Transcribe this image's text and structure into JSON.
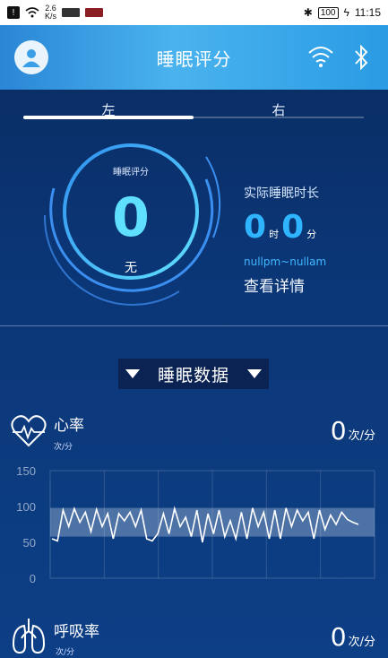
{
  "status_bar": {
    "speed_top": "2.6",
    "speed_bottom": "K/s",
    "battery": "100",
    "time": "11:15"
  },
  "header": {
    "title": "睡眠评分",
    "icons": [
      "avatar-icon",
      "wifi-icon",
      "bluetooth-icon"
    ]
  },
  "tabs": [
    {
      "label": "左",
      "active": true
    },
    {
      "label": "右",
      "active": false
    }
  ],
  "score": {
    "label": "睡眠评分",
    "value": "0",
    "grade": "无"
  },
  "actual_sleep": {
    "title": "实际睡眠时长",
    "hours": "0",
    "hours_unit": "时",
    "minutes": "0",
    "minutes_unit": "分",
    "time_range": "nullpm~nullam",
    "detail_label": "查看详情"
  },
  "section": {
    "title": "睡眠数据"
  },
  "heart_rate": {
    "name": "心率",
    "unit_small": "次/分",
    "value": "0",
    "unit": "次/分"
  },
  "respiration": {
    "name": "呼吸率",
    "unit_small": "次/分",
    "value": "0",
    "unit": "次/分"
  },
  "colors": {
    "accent": "#2fb4ff",
    "score": "#5fe0ff",
    "header": "#3ea6e8"
  },
  "chart_data": {
    "type": "line",
    "ylim": [
      0,
      150
    ],
    "yticks": [
      "150",
      "100",
      "50",
      "0"
    ],
    "band": [
      58,
      98
    ],
    "series": [
      {
        "values": [
          55,
          52,
          95,
          72,
          97,
          78,
          92,
          65,
          96,
          72,
          90,
          55,
          90,
          80,
          92,
          72,
          95,
          55,
          52,
          62,
          90,
          62,
          97,
          72,
          85,
          58,
          95,
          50,
          90,
          62,
          95,
          58,
          80,
          55,
          92,
          55,
          98,
          72,
          92,
          55,
          95,
          55,
          98,
          72,
          95,
          80,
          92,
          55,
          95,
          68,
          88,
          75,
          92,
          82,
          78,
          75
        ]
      }
    ]
  }
}
